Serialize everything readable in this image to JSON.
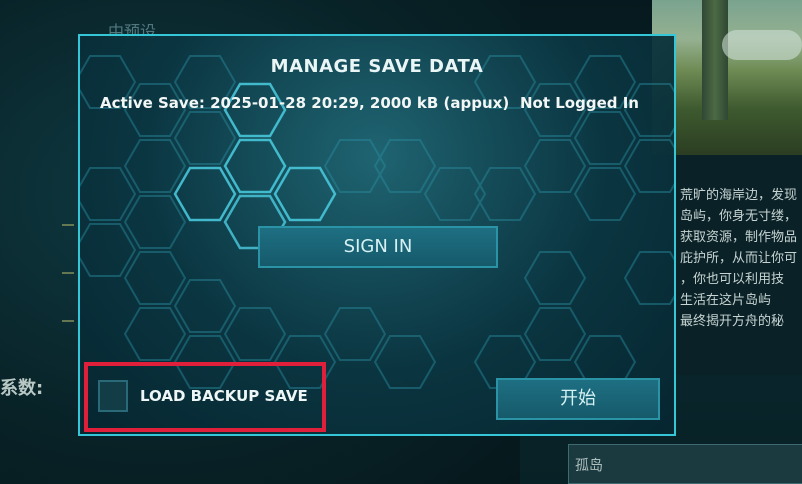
{
  "background": {
    "left_label": "中预设",
    "side_label": "系数:",
    "description_lines": [
      "荒旷的海岸边，发现",
      "岛屿，你身无寸缕，",
      "获取资源，制作物品",
      "庇护所，从而让你可",
      "，你也可以利用技",
      "生活在这片岛屿",
      "最终揭开方舟的秘"
    ],
    "map_field_value": "孤岛"
  },
  "dialog": {
    "title": "MANAGE SAVE DATA",
    "active_save": "Active Save: 2025-01-28 20:29, 2000 kB (app",
    "active_save_suffix": "ux)",
    "login_status": "Not Logged In",
    "sign_in_label": "SIGN IN",
    "load_backup_label": "LOAD BACKUP SAVE",
    "load_backup_checked": false,
    "start_label": "开始"
  },
  "colors": {
    "dialog_border": "#35c6d8",
    "button_fill": "#1e6f82",
    "highlight": "#e0203a"
  }
}
